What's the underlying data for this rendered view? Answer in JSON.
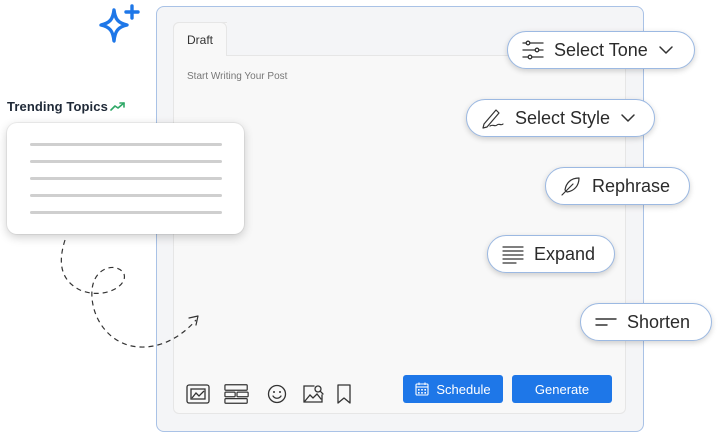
{
  "trending": {
    "label": "Trending Topics"
  },
  "editor": {
    "tab_label": "Draft",
    "placeholder": "Start Writing Your Post"
  },
  "actions": {
    "select_tone": "Select Tone",
    "select_style": "Select Style",
    "rephrase": "Rephrase",
    "expand": "Expand",
    "shorten": "Shorten"
  },
  "buttons": {
    "schedule": "Schedule",
    "generate": "Generate"
  },
  "icons": {
    "logo": "sparkle-icon",
    "trend": "trending-up-icon",
    "toolbar": [
      "image-frame-icon",
      "layout-blocks-icon",
      "emoji-icon",
      "image-search-icon",
      "bookmark-icon"
    ]
  },
  "colors": {
    "accent": "#1e77e8",
    "border": "#9cb9e2",
    "trend": "#2ea866"
  }
}
